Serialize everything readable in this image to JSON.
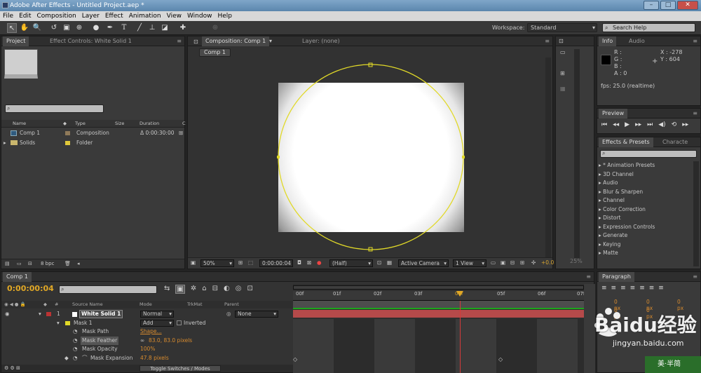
{
  "app": {
    "title": "Adobe After Effects - Untitled Project.aep *",
    "window_buttons": [
      "–",
      "□",
      "✕"
    ]
  },
  "menu": [
    "File",
    "Edit",
    "Composition",
    "Layer",
    "Effect",
    "Animation",
    "View",
    "Window",
    "Help"
  ],
  "toolbar": {
    "workspace_label": "Workspace:",
    "workspace_value": "Standard",
    "search_placeholder": "Search Help"
  },
  "project": {
    "tab": "Project",
    "effect_tab": "Effect Controls: White Solid 1",
    "columns": [
      "Name",
      "Type",
      "Size",
      "Duration",
      "C"
    ],
    "items": [
      {
        "name": "Comp 1",
        "type": "Composition",
        "size": "",
        "duration": "Δ 0:00:30:00",
        "label_color": "#8f7a5a"
      },
      {
        "name": "Solids",
        "type": "Folder",
        "size": "",
        "duration": "",
        "label_color": "#e0c83a"
      }
    ],
    "footer_bpc": "8 bpc"
  },
  "composition": {
    "tab": "Composition: Comp 1",
    "layer_tab": "Layer: (none)",
    "sub_tab": "Comp 1",
    "zoom": "50%",
    "timecode": "0:00:00:04",
    "resolution": "(Half)",
    "camera": "Active Camera",
    "view": "1 View",
    "offset": "+0.0"
  },
  "info": {
    "tab": "Info",
    "audio_tab": "Audio",
    "r": "R :",
    "g": "G :",
    "b": "B :",
    "a": "A : 0",
    "x": "X : -278",
    "y": "Y : 604",
    "fps": "fps: 25.0 (realtime)"
  },
  "preview": {
    "tab": "Preview"
  },
  "effects": {
    "tab": "Effects & Presets",
    "char_tab": "Characte",
    "items": [
      "* Animation Presets",
      "3D Channel",
      "Audio",
      "Blur & Sharpen",
      "Channel",
      "Color Correction",
      "Distort",
      "Expression Controls",
      "Generate",
      "Keying",
      "Matte"
    ]
  },
  "paragraph": {
    "tab": "Paragraph",
    "px": [
      "0 px",
      "0 px",
      "0 px",
      "0 px",
      "0 px"
    ]
  },
  "timeline": {
    "tab": "Comp 1",
    "timecode": "0:00:00:04",
    "columns": {
      "source": "Source Name",
      "mode": "Mode",
      "trkmat": "TrkMat",
      "parent": "Parent"
    },
    "ruler": [
      "00f",
      "01f",
      "02f",
      "03f",
      "04f",
      "05f",
      "06f",
      "07f"
    ],
    "layer": {
      "num": "1",
      "name": "White Solid 1",
      "mode": "Normal",
      "parent": "None"
    },
    "mask": {
      "name": "Mask 1",
      "mode": "Add",
      "inverted": "Inverted"
    },
    "props": [
      {
        "name": "Mask Path",
        "value": "Shape..."
      },
      {
        "name": "Mask Feather",
        "value": "83.0, 83.0 pixels"
      },
      {
        "name": "Mask Opacity",
        "value": "100%"
      },
      {
        "name": "Mask Expansion",
        "value": "47.8 pixels"
      }
    ],
    "toggle": "Toggle Switches / Modes"
  },
  "watermark": {
    "brand": "Baidu经验",
    "url": "jingyan.baidu.com",
    "corner": "美·半简"
  }
}
